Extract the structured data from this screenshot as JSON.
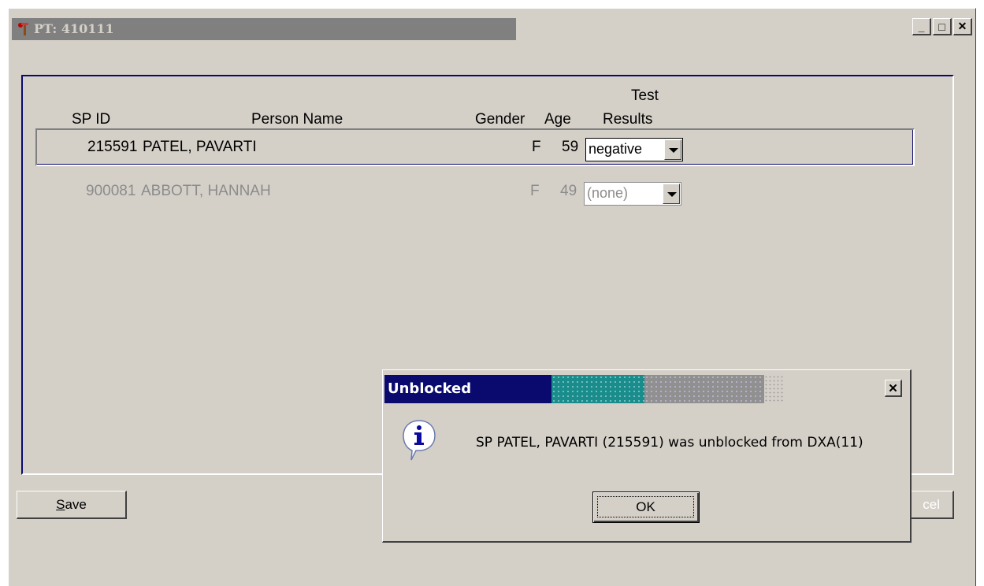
{
  "window": {
    "title": "PT: 410111",
    "min_label": "_",
    "max_label": "□",
    "close_label": "✕"
  },
  "table": {
    "headers": {
      "sp_id": "SP ID",
      "person_name": "Person Name",
      "gender": "Gender",
      "age": "Age",
      "test_top": "Test",
      "test_bottom": "Results"
    },
    "rows": [
      {
        "sp_id": "215591",
        "name": "PATEL, PAVARTI",
        "gender": "F",
        "age": "59",
        "result": "negative"
      },
      {
        "sp_id": "900081",
        "name": "ABBOTT, HANNAH",
        "gender": "F",
        "age": "49",
        "result": "(none)"
      }
    ]
  },
  "buttons": {
    "save": "Save",
    "cancel_partial": "cel"
  },
  "dialog": {
    "title": "Unblocked",
    "close_label": "✕",
    "message": "SP PATEL, PAVARTI  (215591) was unblocked from DXA(11)",
    "ok": "OK"
  },
  "colors": {
    "title_bar_inactive": "#808080",
    "dialog_title": "#0a0a6e",
    "window_bg": "#d4d0c8"
  }
}
